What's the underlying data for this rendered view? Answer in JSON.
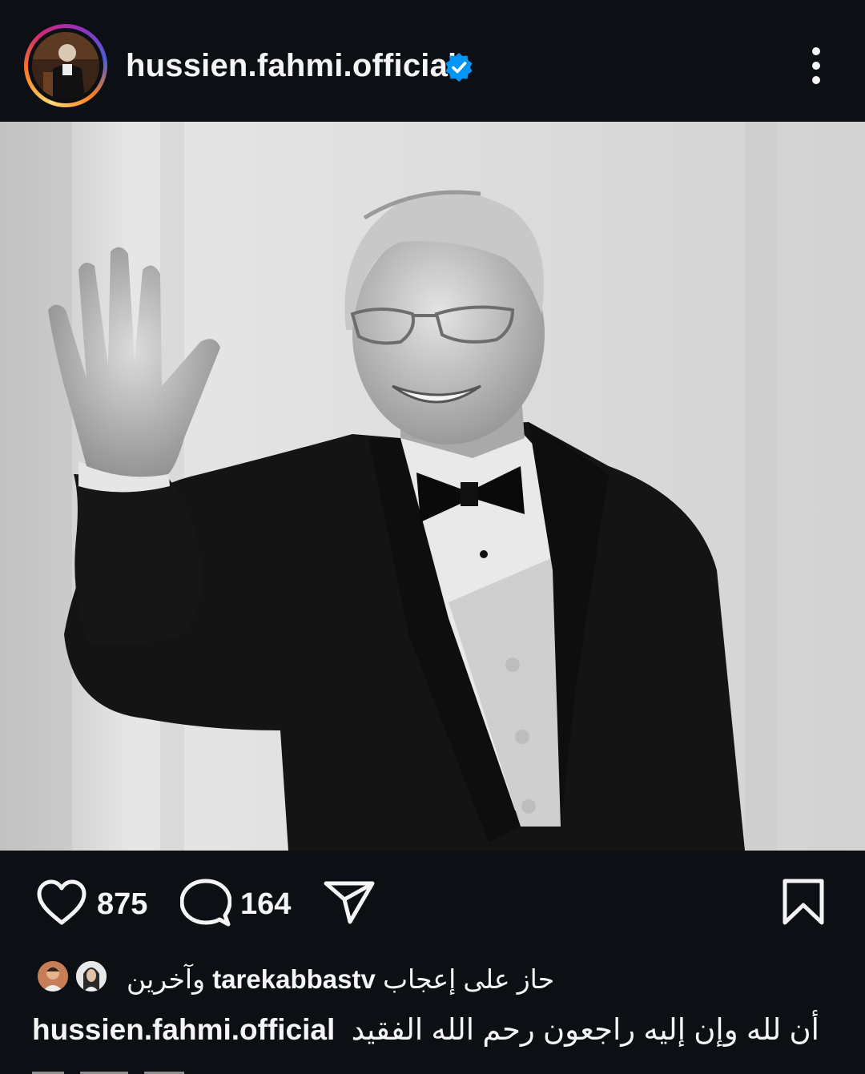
{
  "post": {
    "username": "hussien.fahmi.official",
    "verified": true
  },
  "icons": {
    "verified": "verified-badge-icon",
    "more": "more-vertical-icon",
    "like": "heart-icon",
    "comment": "comment-bubble-icon",
    "share": "paper-plane-icon",
    "save": "bookmark-icon"
  },
  "actions": {
    "likes": "875",
    "comments": "164"
  },
  "liked_by": {
    "prefix": "حاز على إعجاب",
    "user": "tarekabbastv",
    "suffix": "وآخرين"
  },
  "caption": {
    "username": "hussien.fahmi.official",
    "text": "أن لله وإن إليه راجعون رحم الله الفقيد"
  },
  "colors": {
    "background": "#0c1014",
    "text": "#f5f5f5",
    "verified_blue": "#0095f6"
  }
}
